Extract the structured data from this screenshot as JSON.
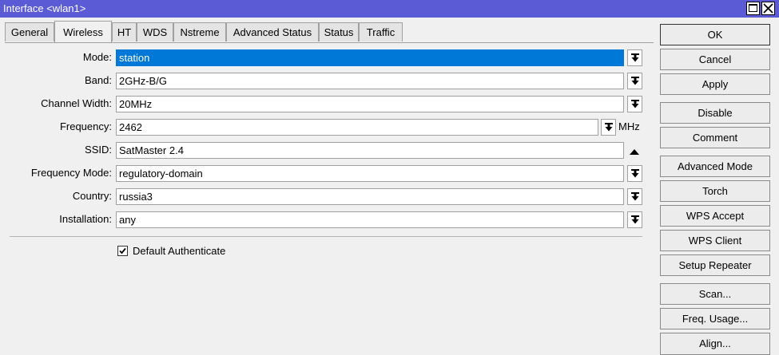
{
  "window": {
    "title": "Interface <wlan1>"
  },
  "tabs": [
    "General",
    "Wireless",
    "HT",
    "WDS",
    "Nstreme",
    "Advanced Status",
    "Status",
    "Traffic"
  ],
  "active_tab": "Wireless",
  "fields": {
    "mode": {
      "label": "Mode:",
      "value": "station"
    },
    "band": {
      "label": "Band:",
      "value": "2GHz-B/G"
    },
    "channel_width": {
      "label": "Channel Width:",
      "value": "20MHz"
    },
    "frequency": {
      "label": "Frequency:",
      "value": "2462",
      "unit": "MHz"
    },
    "ssid": {
      "label": "SSID:",
      "value": "SatMaster 2.4"
    },
    "frequency_mode": {
      "label": "Frequency Mode:",
      "value": "regulatory-domain"
    },
    "country": {
      "label": "Country:",
      "value": "russia3"
    },
    "installation": {
      "label": "Installation:",
      "value": "any"
    }
  },
  "default_authenticate": {
    "label": "Default Authenticate",
    "checked": true
  },
  "buttons": {
    "ok": "OK",
    "cancel": "Cancel",
    "apply": "Apply",
    "disable": "Disable",
    "comment": "Comment",
    "advanced_mode": "Advanced Mode",
    "torch": "Torch",
    "wps_accept": "WPS Accept",
    "wps_client": "WPS Client",
    "setup_repeater": "Setup Repeater",
    "scan": "Scan...",
    "freq_usage": "Freq. Usage...",
    "align": "Align..."
  },
  "icons": {
    "dropdown": "arrow-down-icon",
    "collapse": "triangle-up-icon",
    "maximize": "maximize-icon",
    "close": "close-icon",
    "check": "checkmark-icon"
  },
  "colors": {
    "titlebar": "#5b5bd6",
    "selection": "#0078d7",
    "background": "#f0f0f0"
  }
}
